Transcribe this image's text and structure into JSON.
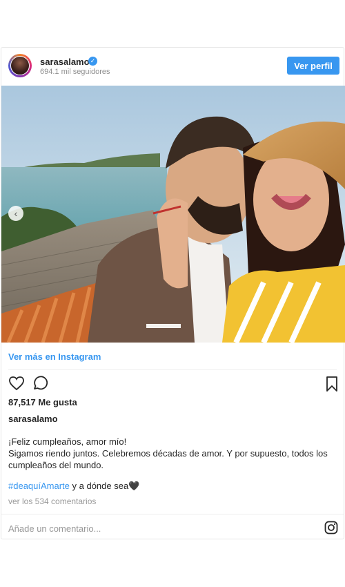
{
  "post": {
    "username": "sarasalamo",
    "followers": "694.1 mil seguidores",
    "view_profile_label": "Ver perfil",
    "view_more_label": "Ver más en Instagram",
    "likes": "87,517 Me gusta",
    "caption_username": "sarasalamo",
    "caption_lines": [
      "¡Feliz cumpleaños, amor mío!",
      "Sigamos riendo juntos. Celebremos décadas de amor. Y por supuesto, todos los cumpleaños del mundo."
    ],
    "hashtag": "#deaquíAmarte",
    "hashtag_suffix": " y a dónde sea🖤",
    "comments_link": "ver los 534 comentarios",
    "comment_placeholder": "Añade un comentario...",
    "icons": {
      "like": "heart-icon",
      "comment": "comment-bubble-icon",
      "save": "bookmark-icon",
      "brand": "instagram-icon",
      "prev": "chevron-left-icon",
      "verified": "verified-badge-icon"
    },
    "colors": {
      "link": "#3897f0",
      "text": "#262626",
      "muted": "#8e8e8e"
    }
  }
}
